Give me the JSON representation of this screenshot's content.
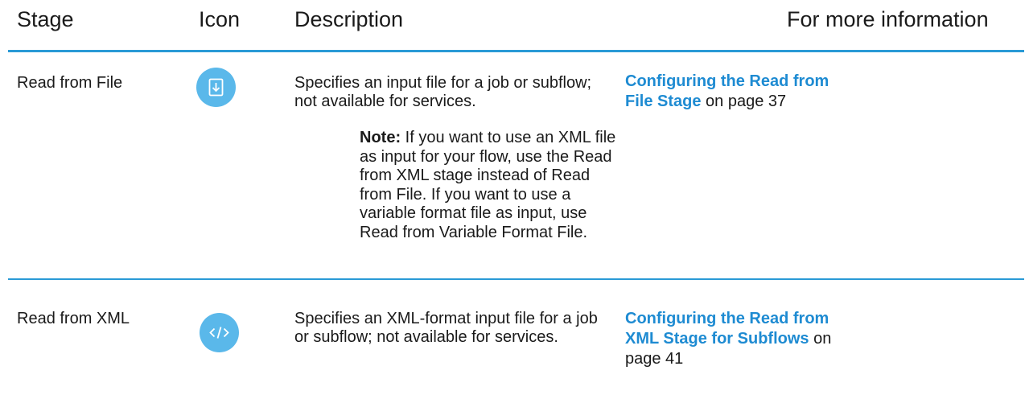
{
  "table": {
    "headers": {
      "stage": "Stage",
      "icon": "Icon",
      "description": "Description",
      "info": "For more information"
    },
    "rows": [
      {
        "stage": "Read from File",
        "icon": "download-icon",
        "description": "Specifies an input file for a job or subflow; not available for services.",
        "note_label": "Note:",
        "note_text": "If you want to use an XML file as input for your flow, use the Read from XML stage instead of Read from File. If you want to use a variable format file as input, use Read from Variable Format File.",
        "link_line1": "Configuring the Read from",
        "link_line2": "File Stage",
        "page_ref": "on page 37"
      },
      {
        "stage": "Read from XML",
        "icon": "code-icon",
        "description": "Specifies an XML-format input file for a job or subflow; not available for services.",
        "link_line1": "Configuring the Read from",
        "link_line2": "XML Stage for Subflows",
        "page_ref_suffix": "on",
        "page_ref_line": "page 41"
      }
    ]
  },
  "colors": {
    "rule": "#2a9ad6",
    "link": "#1e8bd2",
    "icon_bg": "#5ab8ea"
  }
}
